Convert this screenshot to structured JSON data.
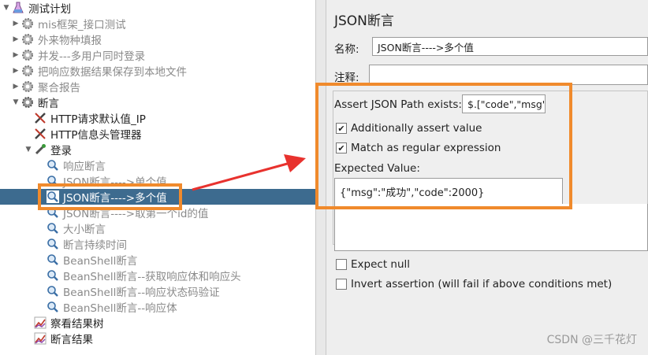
{
  "tree": {
    "items": [
      {
        "label": "测试计划"
      },
      {
        "label": "mis框架_接口测试"
      },
      {
        "label": "外来物种填报"
      },
      {
        "label": "并发---多用户同时登录"
      },
      {
        "label": "把响应数据结果保存到本地文件"
      },
      {
        "label": "聚合报告"
      },
      {
        "label": "断言"
      },
      {
        "label": "HTTP请求默认值_IP"
      },
      {
        "label": "HTTP信息头管理器"
      },
      {
        "label": "登录"
      },
      {
        "label": "响应断言"
      },
      {
        "label": "JSON断言---->单个值"
      },
      {
        "label": "JSON断言---->多个值"
      },
      {
        "label": "JSON断言---->取第一个id的值"
      },
      {
        "label": "大小断言"
      },
      {
        "label": "断言持续时间"
      },
      {
        "label": "BeanShell断言"
      },
      {
        "label": "BeanShell断言--获取响应体和响应头"
      },
      {
        "label": "BeanShell断言--响应状态码验证"
      },
      {
        "label": "BeanShell断言--响应体"
      },
      {
        "label": "察看结果树"
      },
      {
        "label": "断言结果"
      }
    ]
  },
  "panel": {
    "title": "JSON断言",
    "name_label": "名称:",
    "name_value": "JSON断言---->多个值",
    "comment_label": "注释:",
    "comment_value": "",
    "path_label": "Assert JSON Path exists:",
    "path_value": "$.[\"code\",\"msg\"]",
    "additionally_label": "Additionally assert value",
    "additionally_checked": true,
    "regex_label": "Match as regular expression",
    "regex_checked": true,
    "expected_label": "Expected Value:",
    "expected_value": "{\"msg\":\"成功\",\"code\":2000}",
    "expect_null_label": "Expect null",
    "invert_label": "Invert assertion (will fail if above conditions met)"
  },
  "watermark": "CSDN @三千花灯",
  "colors": {
    "highlight_orange": "#f08a2c",
    "arrow_red": "#e8322e",
    "selection_blue": "#3d6b8f"
  }
}
